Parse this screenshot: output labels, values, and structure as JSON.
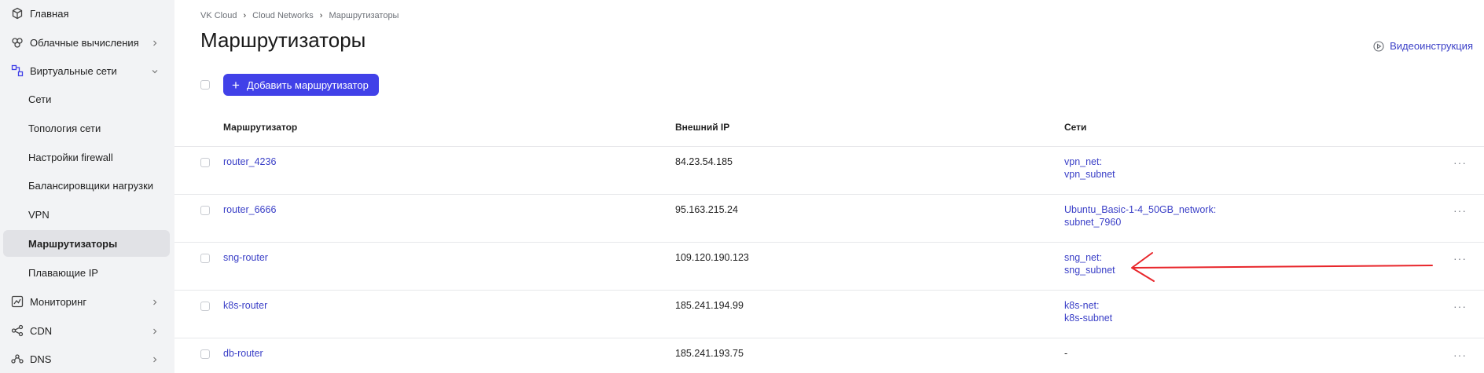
{
  "sidebar": {
    "items": [
      {
        "label": "Главная",
        "icon": "cube-icon"
      },
      {
        "label": "Облачные вычисления",
        "icon": "cloud-compute-icon"
      },
      {
        "label": "Виртуальные сети",
        "icon": "network-icon"
      },
      {
        "label": "Сети"
      },
      {
        "label": "Топология сети"
      },
      {
        "label": "Настройки firewall"
      },
      {
        "label": "Балансировщики нагрузки"
      },
      {
        "label": "VPN"
      },
      {
        "label": "Маршрутизаторы"
      },
      {
        "label": "Плавающие IP"
      },
      {
        "label": "Мониторинг",
        "icon": "chart-line-icon"
      },
      {
        "label": "CDN",
        "icon": "share-icon"
      },
      {
        "label": "DNS",
        "icon": "dns-icon"
      }
    ]
  },
  "breadcrumb": [
    "VK Cloud",
    "Cloud Networks",
    "Маршрутизаторы"
  ],
  "page": {
    "title": "Маршрутизаторы",
    "video_link": "Видеоинструкция",
    "add_button": "Добавить маршрутизатор"
  },
  "table": {
    "columns": [
      "Маршрутизатор",
      "Внешний IP",
      "Сети"
    ],
    "rows": [
      {
        "name": "router_4236",
        "ip": "84.23.54.185",
        "net": "vpn_net:",
        "subnet": "vpn_subnet"
      },
      {
        "name": "router_6666",
        "ip": "95.163.215.24",
        "net": "Ubuntu_Basic-1-4_50GB_network:",
        "subnet": "subnet_7960"
      },
      {
        "name": "sng-router",
        "ip": "109.120.190.123",
        "net": "sng_net:",
        "subnet": "sng_subnet"
      },
      {
        "name": "k8s-router",
        "ip": "185.241.194.99",
        "net": "k8s-net:",
        "subnet": "k8s-subnet"
      },
      {
        "name": "db-router",
        "ip": "185.241.193.75",
        "net": "-",
        "subnet": ""
      }
    ],
    "row_menu": "···"
  },
  "colors": {
    "accent": "#4141e8",
    "link": "#3a3fc7",
    "sidebar_bg": "#f2f3f5",
    "annotation_arrow": "#e8262b"
  }
}
